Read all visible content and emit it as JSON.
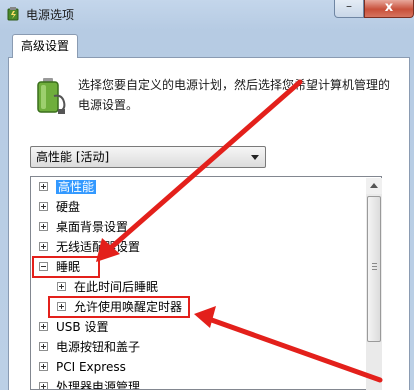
{
  "window": {
    "title": "电源选项",
    "minimize_glyph": "–",
    "close_glyph": "x"
  },
  "tab": {
    "label": "高级设置"
  },
  "description": "选择您要自定义的电源计划，然后选择您希望计算机管理的电源设置。",
  "plan_select": {
    "value": "高性能 [活动]"
  },
  "tree": {
    "items": [
      {
        "label": "高性能",
        "state": "expanded-selected"
      },
      {
        "label": "硬盘",
        "state": "collapsed"
      },
      {
        "label": "桌面背景设置",
        "state": "collapsed"
      },
      {
        "label": "无线适配器设置",
        "state": "collapsed"
      },
      {
        "label": "睡眠",
        "state": "expanded"
      },
      {
        "label": "在此时间后睡眠",
        "state": "collapsed"
      },
      {
        "label": "允许使用唤醒定时器",
        "state": "collapsed"
      },
      {
        "label": "USB 设置",
        "state": "collapsed"
      },
      {
        "label": "电源按钮和盖子",
        "state": "collapsed"
      },
      {
        "label": "PCI Express",
        "state": "collapsed"
      },
      {
        "label": "处理器电源管理",
        "state": "collapsed"
      }
    ]
  },
  "colors": {
    "annotation": "#e3201b",
    "selection": "#3399ff"
  },
  "icons": [
    "power-options-icon",
    "battery-plan-icon",
    "expand-icon",
    "collapse-icon",
    "scroll-up-icon"
  ]
}
